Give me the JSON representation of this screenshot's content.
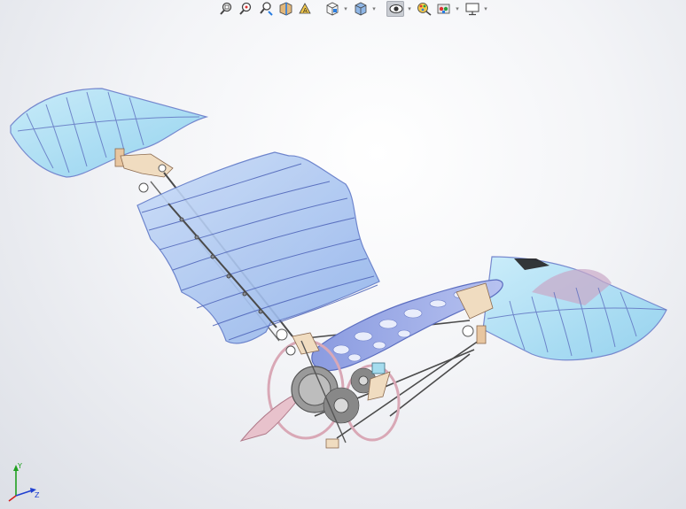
{
  "toolbar": {
    "buttons": [
      {
        "icon": "zoom-to-fit-icon",
        "dropdown": false
      },
      {
        "icon": "zoom-to-area-icon",
        "dropdown": false
      },
      {
        "icon": "previous-view-icon",
        "dropdown": false
      },
      {
        "icon": "section-view-icon",
        "dropdown": false
      },
      {
        "icon": "dynamic-annotation-icon",
        "dropdown": false
      },
      {
        "icon": "view-orientation-icon",
        "dropdown": true
      },
      {
        "icon": "display-style-icon",
        "dropdown": true
      },
      {
        "icon": "hide-show-items-icon",
        "dropdown": true,
        "active": true
      },
      {
        "icon": "edit-appearance-icon",
        "dropdown": false
      },
      {
        "icon": "apply-scene-icon",
        "dropdown": true
      },
      {
        "icon": "view-settings-icon",
        "dropdown": true
      }
    ]
  },
  "triad": {
    "axes": [
      "Y",
      "Z"
    ],
    "colors": {
      "x": "#d02020",
      "y": "#20a020",
      "z": "#2040d0"
    }
  },
  "model": {
    "colors": {
      "wing_fill": "#a9c8f2",
      "wing_stroke": "#5f79c8",
      "tip_fill": "#a6dcf2",
      "frame": "#d9a8b6",
      "bracket": "#f0dcc0",
      "shaft": "#4a4a4a"
    }
  }
}
